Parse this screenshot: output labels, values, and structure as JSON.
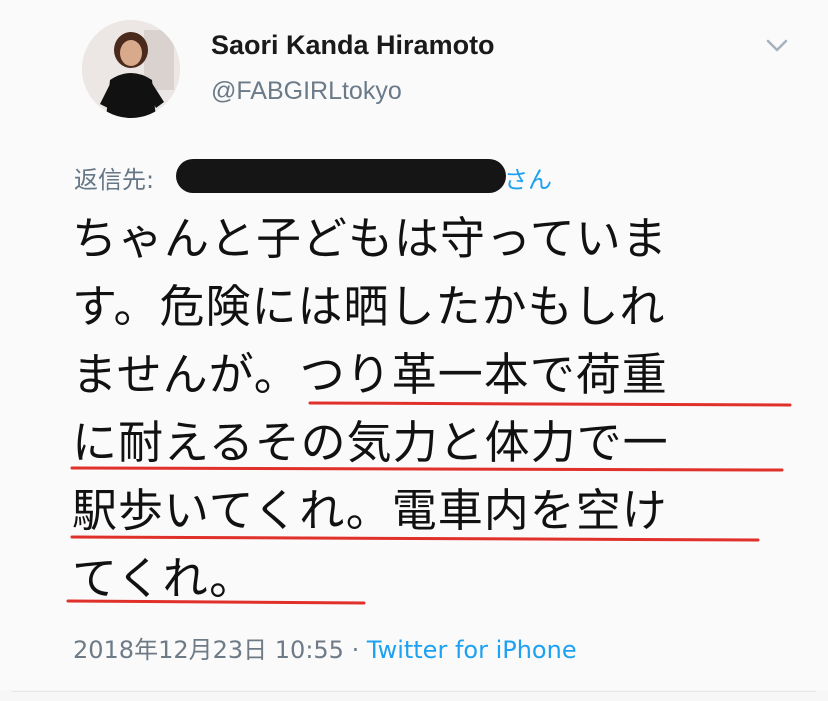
{
  "tweet": {
    "display_name": "Saori Kanda Hiramoto",
    "handle": "@FABGIRLtokyo",
    "reply_prefix": "返信先:",
    "reply_suffix": "さん",
    "lines": [
      "ちゃんと子どもは守っていま",
      "す。危険には晒したかもしれ",
      "ませんが。つり革一本で荷重",
      "に耐えるその気力と体力で一",
      "駅歩いてくれ。電車内を空け",
      "てくれ。"
    ],
    "timestamp": "2018年12月23日 10:55",
    "separator": "·",
    "source": "Twitter for iPhone"
  },
  "colors": {
    "underline": "#e0302a",
    "link": "#1da1f2",
    "secondary_text": "#657786"
  },
  "icons": {
    "menu": "chevron-down-icon",
    "redaction": "redaction-bar"
  }
}
